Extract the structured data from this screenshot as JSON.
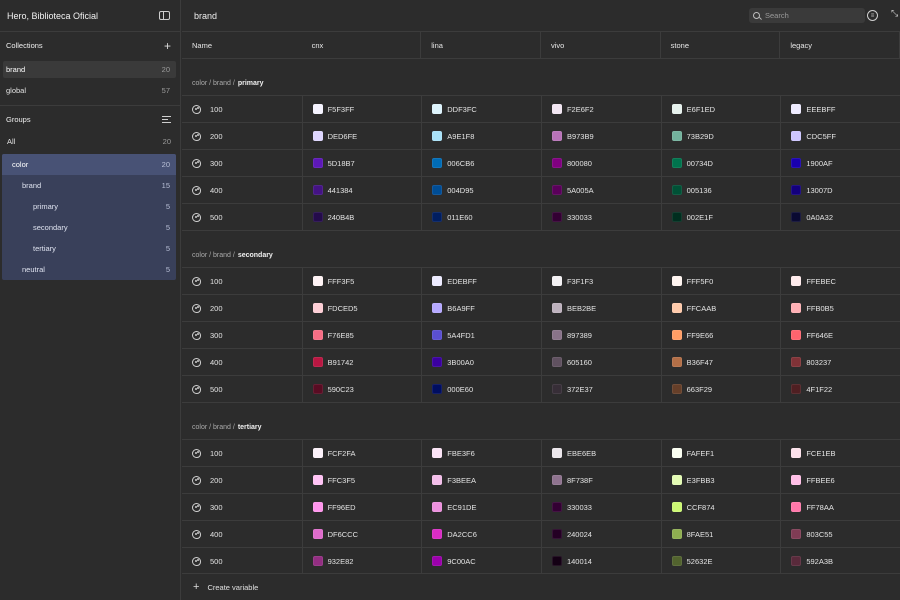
{
  "sidebar": {
    "title": "Hero, Biblioteca Oficial",
    "collections_label": "Collections",
    "collections": [
      {
        "label": "brand",
        "count": "20",
        "active": true
      },
      {
        "label": "global",
        "count": "57",
        "active": false
      }
    ],
    "groups_label": "Groups",
    "groups_all": {
      "label": "All",
      "count": "20"
    },
    "groups_tree": [
      {
        "label": "color",
        "count": "20",
        "level": 0,
        "selected": true
      },
      {
        "label": "brand",
        "count": "15",
        "level": 1,
        "selected": false
      },
      {
        "label": "primary",
        "count": "5",
        "level": 2,
        "selected": false
      },
      {
        "label": "secondary",
        "count": "5",
        "level": 2,
        "selected": false
      },
      {
        "label": "tertiary",
        "count": "5",
        "level": 2,
        "selected": false
      },
      {
        "label": "neutral",
        "count": "5",
        "level": 1,
        "selected": false
      }
    ]
  },
  "topbar": {
    "title": "brand",
    "search_placeholder": "Search"
  },
  "table": {
    "columns": [
      "Name",
      "cnx",
      "lina",
      "vivo",
      "stone",
      "legacy"
    ],
    "groups": [
      {
        "path": "color / brand /",
        "name": "primary",
        "rows": [
          {
            "name": "100",
            "values": [
              "F5F3FF",
              "DDF3FC",
              "F2E6F2",
              "E6F1ED",
              "EEEBFF"
            ]
          },
          {
            "name": "200",
            "values": [
              "DED6FE",
              "A9E1F8",
              "B973B9",
              "73B29D",
              "CDC5FF"
            ]
          },
          {
            "name": "300",
            "values": [
              "5D18B7",
              "006CB6",
              "800080",
              "00734D",
              "1900AF"
            ]
          },
          {
            "name": "400",
            "values": [
              "441384",
              "004D95",
              "5A005A",
              "005136",
              "13007D"
            ]
          },
          {
            "name": "500",
            "values": [
              "240B4B",
              "011E60",
              "330033",
              "002E1F",
              "0A0A32"
            ]
          }
        ]
      },
      {
        "path": "color / brand /",
        "name": "secondary",
        "rows": [
          {
            "name": "100",
            "values": [
              "FFF3F5",
              "EDEBFF",
              "F3F1F3",
              "FFF5F0",
              "FFEBEC"
            ]
          },
          {
            "name": "200",
            "values": [
              "FDCED5",
              "B6A9FF",
              "BEB2BE",
              "FFCAAB",
              "FFB0B5"
            ]
          },
          {
            "name": "300",
            "values": [
              "F76E85",
              "5A4FD1",
              "897389",
              "FF9E66",
              "FF646E"
            ]
          },
          {
            "name": "400",
            "values": [
              "B91742",
              "3B00A0",
              "605160",
              "B36F47",
              "803237"
            ]
          },
          {
            "name": "500",
            "values": [
              "590C23",
              "000E60",
              "372E37",
              "663F29",
              "4F1F22"
            ]
          }
        ]
      },
      {
        "path": "color / brand /",
        "name": "tertiary",
        "rows": [
          {
            "name": "100",
            "values": [
              "FCF2FA",
              "FBE3F6",
              "EBE6EB",
              "FAFEF1",
              "FCE1EB"
            ]
          },
          {
            "name": "200",
            "values": [
              "FFC3F5",
              "F3BEEA",
              "8F738F",
              "E3FBB3",
              "FFBEE6"
            ]
          },
          {
            "name": "300",
            "values": [
              "FF96ED",
              "EC91DE",
              "330033",
              "CCF874",
              "FF78AA"
            ]
          },
          {
            "name": "400",
            "values": [
              "DF6CCC",
              "DA2CC6",
              "240024",
              "8FAE51",
              "803C55"
            ]
          },
          {
            "name": "500",
            "values": [
              "932E82",
              "9C00AC",
              "140014",
              "52632E",
              "592A3B"
            ]
          }
        ]
      }
    ]
  },
  "footer": {
    "create_label": "Create variable"
  }
}
